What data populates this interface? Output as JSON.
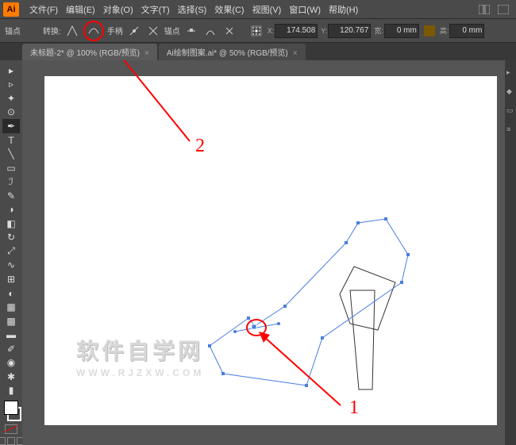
{
  "menu": {
    "items": [
      "文件(F)",
      "编辑(E)",
      "对象(O)",
      "文字(T)",
      "选择(S)",
      "效果(C)",
      "视图(V)",
      "窗口(W)",
      "帮助(H)"
    ]
  },
  "controlbar": {
    "anchor_label": "锚点",
    "convert_label": "转换:",
    "handle_label": "手柄",
    "anchors_label": "锚点",
    "x_label": "X:",
    "y_label": "Y:",
    "w_label": "宽:",
    "h_label": "高:",
    "x_value": "174.508",
    "y_value": "120.767",
    "w_value": "0 mm",
    "h_value": "0 mm"
  },
  "tabs": [
    {
      "label": "未标题-2* @ 100% (RGB/预览)",
      "active": true
    },
    {
      "label": "Ai绘制图案.ai* @ 50% (RGB/预览)",
      "active": false
    }
  ],
  "tools_left": [
    {
      "name": "selection-tool",
      "glyph": "▸"
    },
    {
      "name": "direct-selection-tool",
      "glyph": "▹"
    },
    {
      "name": "magic-wand-tool",
      "glyph": "✦"
    },
    {
      "name": "lasso-tool",
      "glyph": "⊙"
    },
    {
      "name": "pen-tool",
      "glyph": "✒",
      "active": true
    },
    {
      "name": "type-tool",
      "glyph": "T"
    },
    {
      "name": "line-tool",
      "glyph": "╲"
    },
    {
      "name": "rectangle-tool",
      "glyph": "▭"
    },
    {
      "name": "paintbrush-tool",
      "glyph": "ℐ"
    },
    {
      "name": "pencil-tool",
      "glyph": "✎"
    },
    {
      "name": "blob-brush-tool",
      "glyph": "◑"
    },
    {
      "name": "eraser-tool",
      "glyph": "◧"
    },
    {
      "name": "rotate-tool",
      "glyph": "↻"
    },
    {
      "name": "scale-tool",
      "glyph": "⤢"
    },
    {
      "name": "width-tool",
      "glyph": "∿"
    },
    {
      "name": "free-transform-tool",
      "glyph": "⊞"
    },
    {
      "name": "shape-builder-tool",
      "glyph": "◐"
    },
    {
      "name": "perspective-tool",
      "glyph": "▦"
    },
    {
      "name": "mesh-tool",
      "glyph": "▩"
    },
    {
      "name": "gradient-tool",
      "glyph": "▬"
    },
    {
      "name": "eyedropper-tool",
      "glyph": "✐"
    },
    {
      "name": "blend-tool",
      "glyph": "◉"
    },
    {
      "name": "symbol-sprayer-tool",
      "glyph": "✱"
    },
    {
      "name": "column-graph-tool",
      "glyph": "▮"
    }
  ],
  "annotations": {
    "label1": "1",
    "label2": "2"
  },
  "watermark": {
    "cn": "软件自学网",
    "en": "WWW.RJZXW.COM"
  }
}
